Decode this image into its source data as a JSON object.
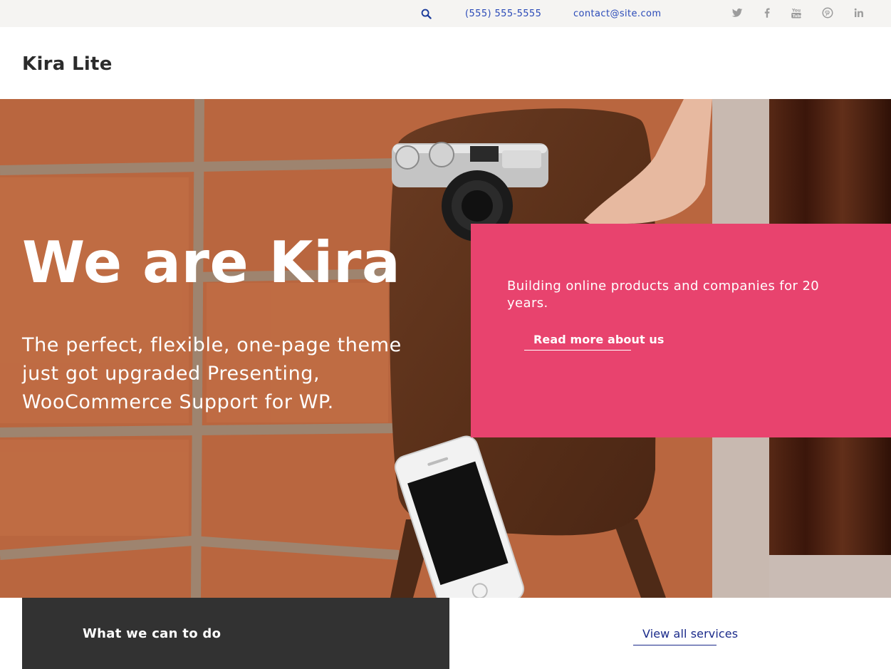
{
  "topbar": {
    "phone": "(555) 555-5555",
    "email": "contact@site.com",
    "icons": [
      "search-icon",
      "twitter-icon",
      "facebook-icon",
      "youtube-icon",
      "pinterest-icon",
      "linkedin-icon"
    ]
  },
  "header": {
    "logo": "Kira Lite"
  },
  "hero": {
    "title": "We are Kira",
    "subtitle": "The perfect, flexible, one-page theme just got upgraded Presenting, WooCommerce Support for WP."
  },
  "card": {
    "text": "Building online products and companies for 20 years.",
    "link": "Read more about us"
  },
  "services": {
    "title": "What we can to do",
    "view_all": "View all services"
  },
  "colors": {
    "accent": "#e8436e",
    "link": "#2a4ab8",
    "dark_box": "#323232",
    "topbar_bg": "#f5f4f2"
  }
}
